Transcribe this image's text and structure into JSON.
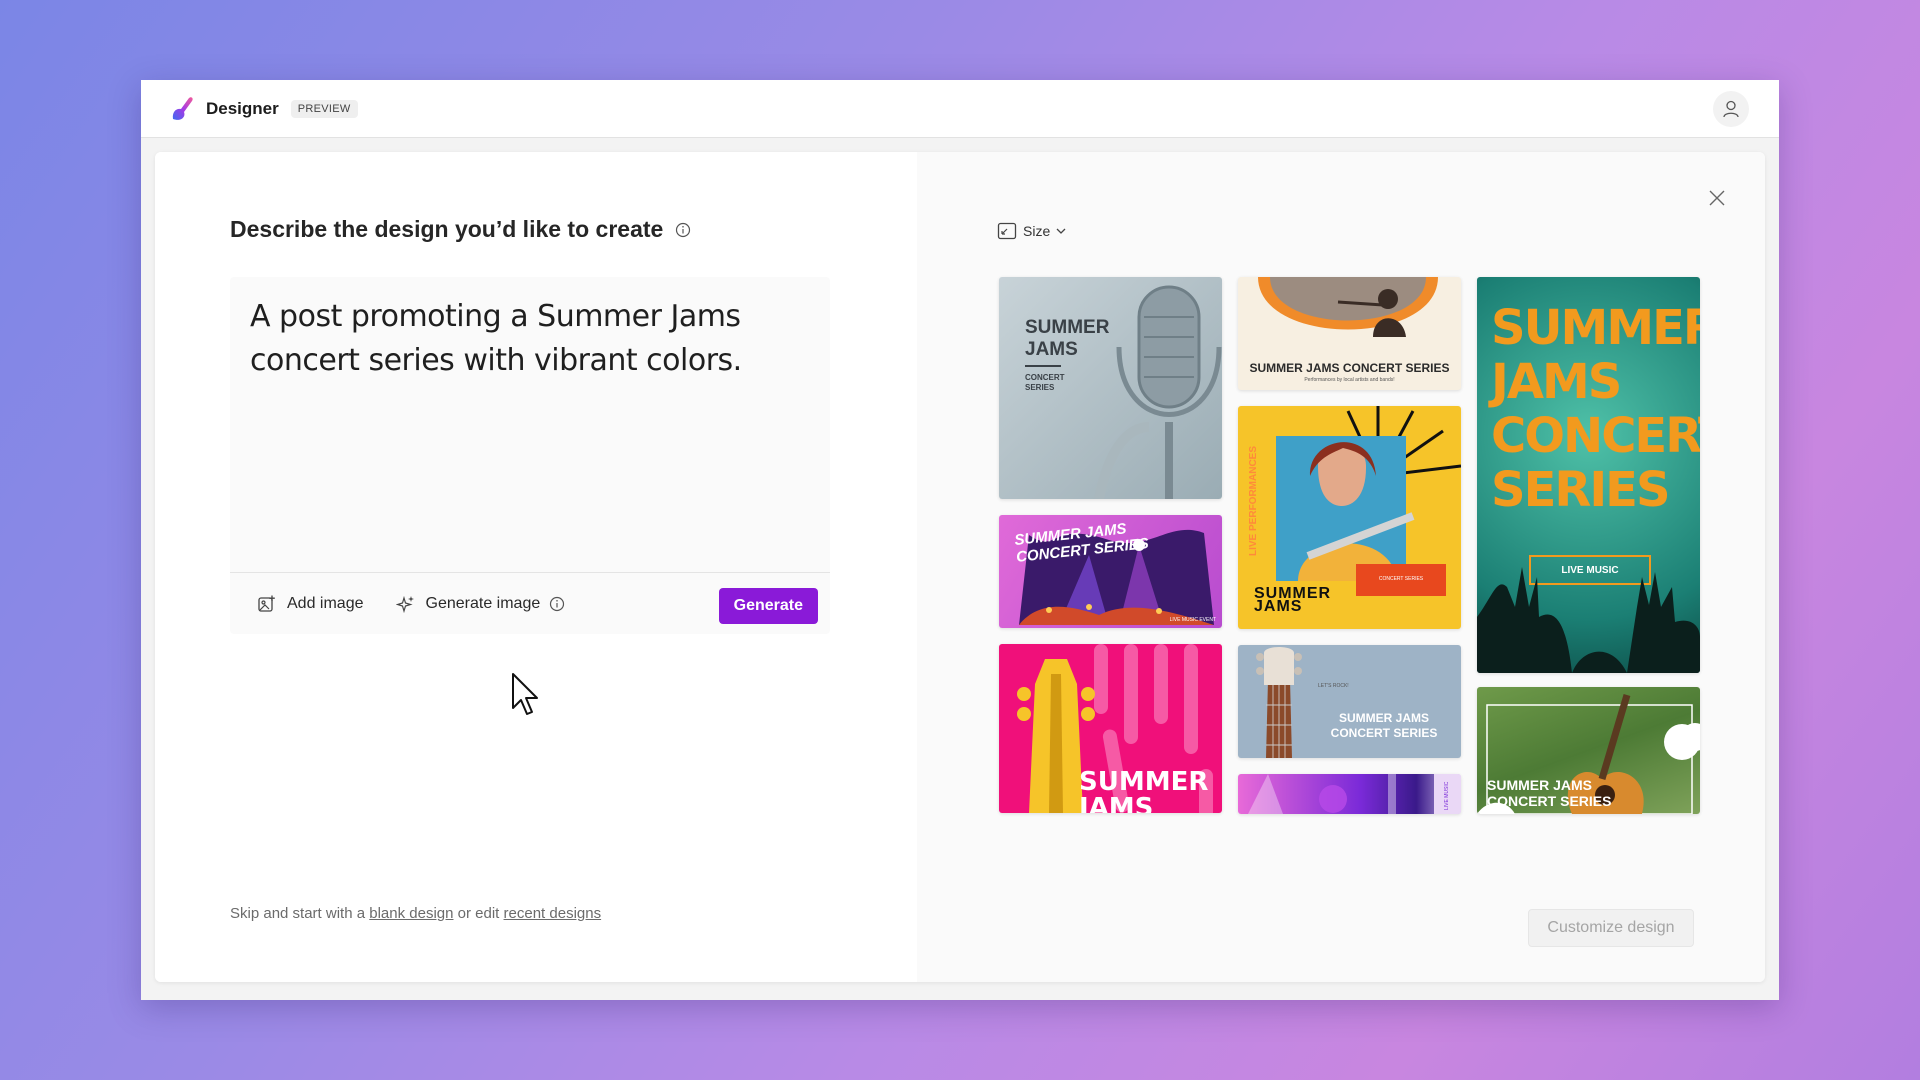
{
  "app": {
    "name": "Designer",
    "badge": "PREVIEW"
  },
  "composer": {
    "heading": "Describe the design you’d like to create",
    "prompt": "A post promoting a Summer Jams concert series with vibrant colors.",
    "add_image": "Add image",
    "generate_image": "Generate image",
    "generate": "Generate"
  },
  "footer": {
    "prefix": "Skip and start with a",
    "blank_link": "blank design",
    "middle": "or edit",
    "recent_link": "recent designs"
  },
  "preview": {
    "size_label": "Size",
    "customize": "Customize design",
    "designs": [
      {
        "lines": [
          "SUMMER",
          "JAMS"
        ],
        "sub": "CONCERT SERIES"
      },
      {
        "lines": [
          "SUMMER JAMS CONCERT SERIES"
        ],
        "sub": "Performances by local artists and bands!"
      },
      {
        "lines": [
          "SUMMER",
          "JAMS",
          "CONCERT",
          "SERIES"
        ],
        "sub": "LIVE MUSIC"
      },
      {
        "lines": [
          "SUMMER JAMS",
          "CONCERT SERIES"
        ],
        "sub": "LIVE MUSIC EVENT"
      },
      {
        "lines": [
          "SUMMER",
          "JAMS"
        ],
        "side": "LIVE PERFORMANCES",
        "sub": "CONCERT SERIES"
      },
      {
        "lines": [
          "SUMMER",
          "JAMS"
        ]
      },
      {
        "lines": [
          "SUMMER JAMS",
          "CONCERT SERIES"
        ],
        "sub": "LET'S ROCK!"
      },
      {
        "lines": [
          "SUMMER JAMS",
          "CONCERT SERIES"
        ]
      },
      {
        "lines": [],
        "side": "LIVE MUSIC"
      }
    ]
  },
  "colors": {
    "accent": "#8a1ad8",
    "pink": "#f0107a",
    "yellow": "#f6c429",
    "teal": "#1aa39a"
  }
}
